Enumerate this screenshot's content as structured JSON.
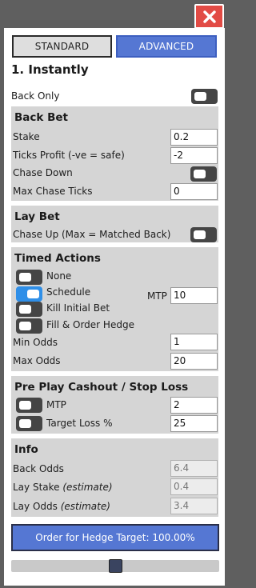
{
  "window": {
    "close_icon": "close-x-icon",
    "close_color": "#e24b45"
  },
  "modes": {
    "standard": "STANDARD",
    "advanced": "ADVANCED",
    "active": "advanced"
  },
  "heading": "1. Instantly",
  "back_only": {
    "label": "Back Only",
    "on": false
  },
  "back_bet": {
    "title": "Back Bet",
    "stake_label": "Stake",
    "stake": "0.2",
    "ticks_label": "Ticks Profit (-ve = safe)",
    "ticks": "-2",
    "chase_label": "Chase Down",
    "chase_on": false,
    "max_chase_label": "Max Chase Ticks",
    "max_chase": "0"
  },
  "lay_bet": {
    "title": "Lay Bet",
    "chase_up_label": "Chase Up (Max = Matched Back)",
    "chase_up_on": false
  },
  "timed": {
    "title": "Timed Actions",
    "none_label": "None",
    "none_on": false,
    "schedule_label": "Schedule",
    "schedule_on": true,
    "mtp_label": "MTP",
    "mtp": "10",
    "kill_label": "Kill Initial Bet",
    "kill_on": false,
    "fill_label": "Fill & Order Hedge",
    "fill_on": false,
    "min_odds_label": "Min Odds",
    "min_odds": "1",
    "max_odds_label": "Max Odds",
    "max_odds": "20"
  },
  "cashout": {
    "title": "Pre Play Cashout / Stop Loss",
    "mtp_label": "MTP",
    "mtp_on": false,
    "mtp": "2",
    "target_label": "Target Loss %",
    "target_on": false,
    "target": "25"
  },
  "info": {
    "title": "Info",
    "back_odds_label": "Back Odds",
    "back_odds": "6.4",
    "lay_stake_label": "Lay Stake",
    "lay_odds_label": "Lay Odds",
    "estimate": "(estimate)",
    "lay_stake": "0.4",
    "lay_odds": "3.4"
  },
  "order_button": "Order for Hedge Target: 100.00%",
  "hedge_slider": {
    "value_fraction": 0.5
  },
  "colors": {
    "accent": "#5577d3",
    "toggle_on": "#2f8fe8",
    "toggle_off": "#454545",
    "section_bg": "#d5d5d5"
  }
}
